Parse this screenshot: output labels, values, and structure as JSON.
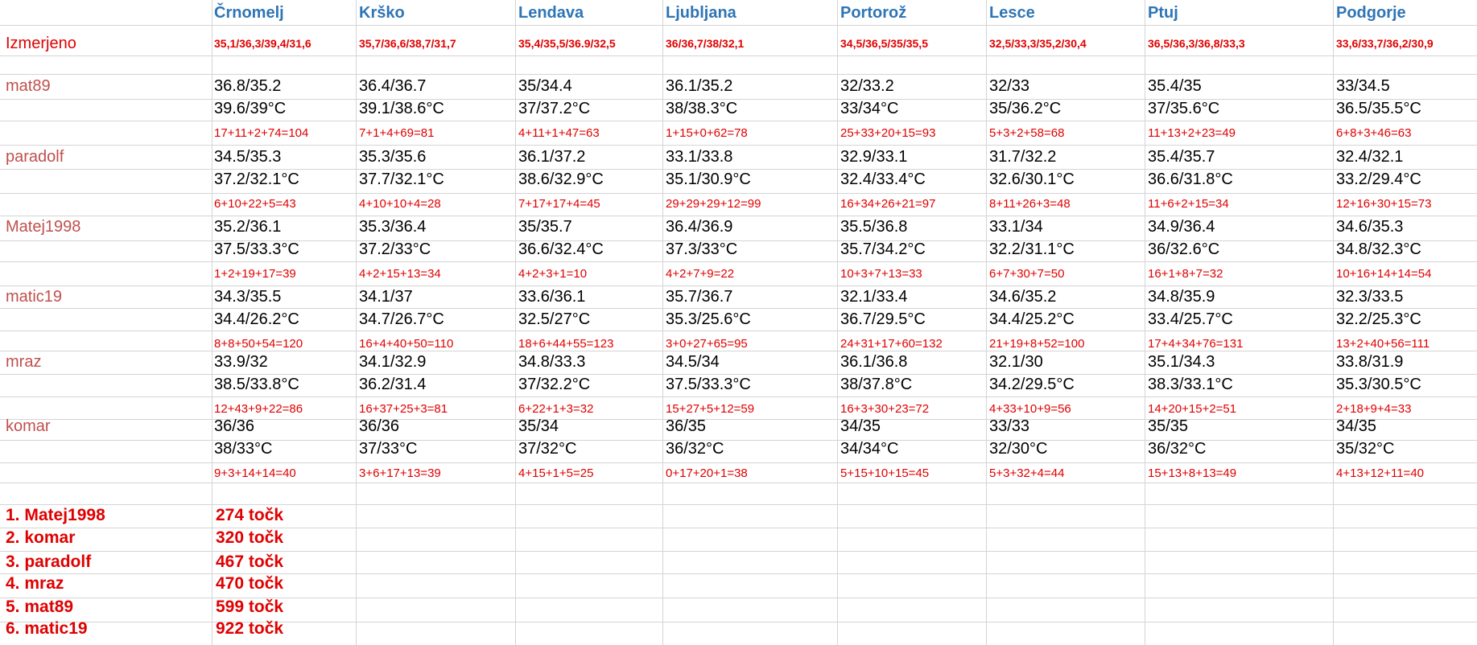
{
  "cities": [
    "Črnomelj",
    "Krško",
    "Lendava",
    "Ljubljana",
    "Portorož",
    "Lesce",
    "Ptuj",
    "Podgorje"
  ],
  "measured_label": "Izmerjeno",
  "measured": [
    "35,1/36,3/39,4/31,6",
    "35,7/36,6/38,7/31,7",
    "35,4/35,5/36.9/32,5",
    "36/36,7/38/32,1",
    "34,5/36,5/35/35,5",
    "32,5/33,3/35,2/30,4",
    "36,5/36,3/36,8/33,3",
    "33,6/33,7/36,2/30,9"
  ],
  "forecasters": [
    {
      "name": "mat89",
      "line1": [
        "36.8/35.2",
        "36.4/36.7",
        "35/34.4",
        "36.1/35.2",
        "32/33.2",
        "32/33",
        "35.4/35",
        "33/34.5"
      ],
      "line2": [
        "39.6/39°C",
        "39.1/38.6°C",
        "37/37.2°C",
        "38/38.3°C",
        "33/34°C",
        "35/36.2°C",
        "37/35.6°C",
        "36.5/35.5°C"
      ],
      "scores": [
        "17+11+2+74=104",
        "7+1+4+69=81",
        "4+11+1+47=63",
        "1+15+0+62=78",
        "25+33+20+15=93",
        "5+3+2+58=68",
        "11+13+2+23=49",
        "6+8+3+46=63"
      ]
    },
    {
      "name": "paradolf",
      "line1": [
        "34.5/35.3",
        "35.3/35.6",
        "36.1/37.2",
        "33.1/33.8",
        "32.9/33.1",
        "31.7/32.2",
        "35.4/35.7",
        "32.4/32.1"
      ],
      "line2": [
        "37.2/32.1°C",
        "37.7/32.1°C",
        "38.6/32.9°C",
        "35.1/30.9°C",
        "32.4/33.4°C",
        "32.6/30.1°C",
        "36.6/31.8°C",
        "33.2/29.4°C"
      ],
      "scores": [
        "6+10+22+5=43",
        "4+10+10+4=28",
        "7+17+17+4=45",
        "29+29+29+12=99",
        "16+34+26+21=97",
        "8+11+26+3=48",
        "11+6+2+15=34",
        "12+16+30+15=73"
      ]
    },
    {
      "name": "Matej1998",
      "line1": [
        "35.2/36.1",
        "35.3/36.4",
        "35/35.7",
        "36.4/36.9",
        "35.5/36.8",
        "33.1/34",
        "34.9/36.4",
        "34.6/35.3"
      ],
      "line2": [
        "37.5/33.3°C",
        "37.2/33°C",
        "36.6/32.4°C",
        "37.3/33°C",
        "35.7/34.2°C",
        "32.2/31.1°C",
        "36/32.6°C",
        "34.8/32.3°C"
      ],
      "scores": [
        "1+2+19+17=39",
        "4+2+15+13=34",
        "4+2+3+1=10",
        "4+2+7+9=22",
        "10+3+7+13=33",
        "6+7+30+7=50",
        "16+1+8+7=32",
        "10+16+14+14=54"
      ]
    },
    {
      "name": "matic19",
      "line1": [
        "34.3/35.5",
        "34.1/37",
        "33.6/36.1",
        "35.7/36.7",
        "32.1/33.4",
        "34.6/35.2",
        "34.8/35.9",
        "32.3/33.5"
      ],
      "line2": [
        "34.4/26.2°C",
        "34.7/26.7°C",
        "32.5/27°C",
        "35.3/25.6°C",
        "36.7/29.5°C",
        "34.4/25.2°C",
        "33.4/25.7°C",
        "32.2/25.3°C"
      ],
      "scores": [
        "8+8+50+54=120",
        "16+4+40+50=110",
        "18+6+44+55=123",
        "3+0+27+65=95",
        "24+31+17+60=132",
        "21+19+8+52=100",
        "17+4+34+76=131",
        "13+2+40+56=111"
      ]
    },
    {
      "name": "mraz",
      "line1": [
        "33.9/32",
        "34.1/32.9",
        "34.8/33.3",
        "34.5/34",
        "36.1/36.8",
        "32.1/30",
        "35.1/34.3",
        "33.8/31.9"
      ],
      "line2": [
        "38.5/33.8°C",
        "36.2/31.4",
        "37/32.2°C",
        "37.5/33.3°C",
        "38/37.8°C",
        "34.2/29.5°C",
        "38.3/33.1°C",
        "35.3/30.5°C"
      ],
      "scores": [
        "12+43+9+22=86",
        "16+37+25+3=81",
        "6+22+1+3=32",
        "15+27+5+12=59",
        "16+3+30+23=72",
        "4+33+10+9=56",
        "14+20+15+2=51",
        "2+18+9+4=33"
      ]
    },
    {
      "name": "komar",
      "line1": [
        "36/36",
        "36/36",
        "35/34",
        "36/35",
        "34/35",
        "33/33",
        "35/35",
        "34/35"
      ],
      "line2": [
        "38/33°C",
        "37/33°C",
        "37/32°C",
        "36/32°C",
        "34/34°C",
        "32/30°C",
        "36/32°C",
        "35/32°C"
      ],
      "scores": [
        "9+3+14+14=40",
        "3+6+17+13=39",
        "4+15+1+5=25",
        "0+17+20+1=38",
        "5+15+10+15=45",
        "5+3+32+4=44",
        "15+13+8+13=49",
        "4+13+12+11=40"
      ]
    }
  ],
  "ranking": [
    {
      "place": "1. Matej1998",
      "points": "274 točk"
    },
    {
      "place": "2. komar",
      "points": "320 točk"
    },
    {
      "place": "3. paradolf",
      "points": "467 točk"
    },
    {
      "place": "4. mraz",
      "points": "470 točk"
    },
    {
      "place": "5. mat89",
      "points": "599 točk"
    },
    {
      "place": "6. matic19",
      "points": "922 točk"
    }
  ]
}
